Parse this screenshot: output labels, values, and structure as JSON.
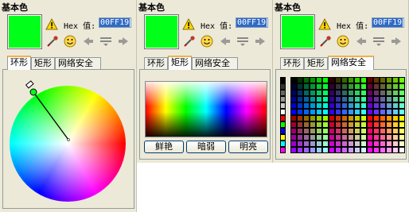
{
  "panels": [
    {
      "title": "基本色",
      "hex_label": "Hex 值:",
      "hex_value": "00FF19",
      "tabs": [
        "环形",
        "矩形",
        "网络安全"
      ],
      "active_tab": 0
    },
    {
      "title": "基本色",
      "hex_label": "Hex 值:",
      "hex_value": "00FF19",
      "tabs": [
        "环形",
        "矩形",
        "网络安全"
      ],
      "active_tab": 1,
      "buttons": [
        "鲜艳",
        "暗弱",
        "明亮"
      ]
    },
    {
      "title": "基本色",
      "hex_label": "Hex 值:",
      "hex_value": "00FF19",
      "tabs": [
        "环形",
        "矩形",
        "网络安全"
      ],
      "active_tab": 2
    }
  ],
  "colors": {
    "current": "#00FF19",
    "panel_bg": "#ECE9D8",
    "tab_accent": "#F1B24A"
  },
  "icons": [
    "warning-icon",
    "eyedropper-icon",
    "smiley-icon",
    "arrow-left-icon",
    "menu-icon",
    "arrow-right-icon"
  ]
}
